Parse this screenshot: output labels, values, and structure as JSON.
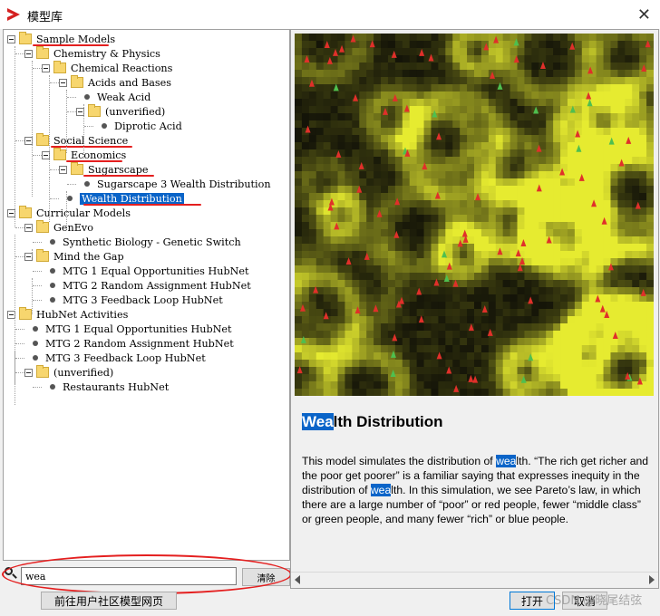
{
  "window": {
    "title": "模型库"
  },
  "tree": {
    "items": [
      {
        "label": "Sample Models",
        "type": "folder",
        "expanded": true,
        "level": 0
      },
      {
        "label": "Chemistry & Physics",
        "type": "folder",
        "expanded": true,
        "level": 1
      },
      {
        "label": "Chemical Reactions",
        "type": "folder",
        "expanded": true,
        "level": 2
      },
      {
        "label": "Acids and Bases",
        "type": "folder",
        "expanded": true,
        "level": 3
      },
      {
        "label": "Weak Acid",
        "type": "leaf",
        "level": 4
      },
      {
        "label": "(unverified)",
        "type": "folder",
        "expanded": true,
        "level": 4
      },
      {
        "label": "Diprotic Acid",
        "type": "leaf",
        "level": 5
      },
      {
        "label": "Social Science",
        "type": "folder",
        "expanded": true,
        "level": 1
      },
      {
        "label": "Economics",
        "type": "folder",
        "expanded": true,
        "level": 2
      },
      {
        "label": "Sugarscape",
        "type": "folder",
        "expanded": true,
        "level": 3
      },
      {
        "label": "Sugarscape 3 Wealth Distribution",
        "type": "leaf",
        "level": 4
      },
      {
        "label": "Wealth Distribution",
        "type": "leaf",
        "level": 3,
        "selected": true
      },
      {
        "label": "Curricular Models",
        "type": "folder",
        "expanded": true,
        "level": 0
      },
      {
        "label": "GenEvo",
        "type": "folder",
        "expanded": true,
        "level": 1
      },
      {
        "label": "Synthetic Biology - Genetic Switch",
        "type": "leaf",
        "level": 2
      },
      {
        "label": "Mind the Gap",
        "type": "folder",
        "expanded": true,
        "level": 1
      },
      {
        "label": "MTG 1 Equal Opportunities HubNet",
        "type": "leaf",
        "level": 2
      },
      {
        "label": "MTG 2 Random Assignment HubNet",
        "type": "leaf",
        "level": 2
      },
      {
        "label": "MTG 3 Feedback Loop HubNet",
        "type": "leaf",
        "level": 2
      },
      {
        "label": "HubNet Activities",
        "type": "folder",
        "expanded": true,
        "level": 0
      },
      {
        "label": "MTG 1 Equal Opportunities HubNet",
        "type": "leaf",
        "level": 1
      },
      {
        "label": "MTG 2 Random Assignment HubNet",
        "type": "leaf",
        "level": 1
      },
      {
        "label": "MTG 3 Feedback Loop HubNet",
        "type": "leaf",
        "level": 1
      },
      {
        "label": "(unverified)",
        "type": "folder",
        "expanded": true,
        "level": 1
      },
      {
        "label": "Restaurants HubNet",
        "type": "leaf",
        "level": 2
      }
    ]
  },
  "search": {
    "value": "wea",
    "clear_label": "清除"
  },
  "preview": {
    "title_highlight": "Wea",
    "title_rest": "lth Distribution",
    "description": [
      {
        "t": "This model simulates the distribution of ",
        "h": false
      },
      {
        "t": "wea",
        "h": true
      },
      {
        "t": "lth. “The rich get richer and the poor get poorer” is a familiar saying that expresses inequity in the distribution of ",
        "h": false
      },
      {
        "t": "wea",
        "h": true
      },
      {
        "t": "lth. In this simulation, we see Pareto’s law, in which there are a large number of “poor” or red people, fewer “middle class” or green people, and many fewer “rich” or blue people.",
        "h": false
      }
    ]
  },
  "buttons": {
    "community": "前往用户社区模型网页",
    "open": "打开",
    "cancel": "取消"
  },
  "watermark": "CSDN @晓尾结弦",
  "colors": {
    "selection": "#0a64c8",
    "annotation": "#e41f1f",
    "folder": "#f7d66e"
  }
}
